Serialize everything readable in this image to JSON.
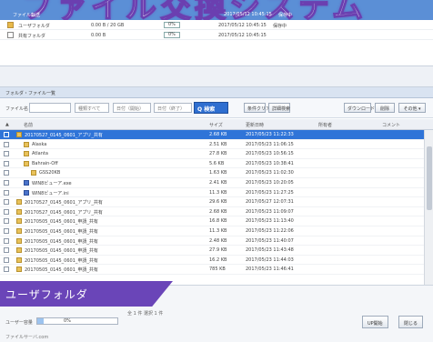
{
  "banner": {
    "title": "ファイル交換システム"
  },
  "upper_list": {
    "selected_row": {
      "name": "ファイル転送",
      "date": "2017/05/12 10:45:15",
      "status": "保存中"
    },
    "rows": [
      {
        "name": "ユーザフォルダ",
        "size": "0.00 B / 20 GB",
        "pct": "0%",
        "date": "2017/05/12 10:45:15",
        "status": "保存中"
      },
      {
        "name": "共有フォルダ",
        "size": "0.00 B",
        "pct": "0%",
        "date": "2017/05/12 10:45:15",
        "status": ""
      }
    ]
  },
  "panel_header": "フォルダ・ファイル一覧",
  "toolbar": {
    "filter_label": "ファイル名",
    "filter_value": "",
    "type_select": "種類すべて",
    "date_from": "日付（開始）",
    "date_to": "日付（終了）",
    "search_label": "Q 検索",
    "btn_clear": "条件クリア",
    "btn_detail": "詳細検索",
    "btn_download": "ダウンロード",
    "btn_delete": "削除",
    "btn_other": "その他 ▾"
  },
  "list_headers": {
    "name": "名前",
    "size": "サイズ",
    "updated": "更新日時",
    "owner": "所有者",
    "comment": "コメント"
  },
  "files": [
    {
      "name": "20170527_0145_0601_アプリ_共有",
      "size": "2.68 KB",
      "date": "2017/05/23 11:22:33",
      "icon": "folder",
      "selected": true,
      "indent": 0
    },
    {
      "name": "Alaska",
      "size": "2.51 KB",
      "date": "2017/05/23 11:06:15",
      "icon": "folder",
      "selected": false,
      "indent": 1
    },
    {
      "name": "Atlanta",
      "size": "27.8 KB",
      "date": "2017/05/23 10:56:15",
      "icon": "folder",
      "selected": false,
      "indent": 1
    },
    {
      "name": "Bahrain-Off",
      "size": "5.6 KB",
      "date": "2017/05/23 10:38:41",
      "icon": "folder",
      "selected": false,
      "indent": 1
    },
    {
      "name": "GSS20KB",
      "size": "1.63 KB",
      "date": "2017/05/23 11:02:30",
      "icon": "folder",
      "selected": false,
      "indent": 2
    },
    {
      "name": "WIN8ビューア.exe",
      "size": "2.41 KB",
      "date": "2017/05/23 10:20:05",
      "icon": "doc",
      "selected": false,
      "indent": 1
    },
    {
      "name": "WIN8ビューア.ini",
      "size": "11.3 KB",
      "date": "2017/05/23 11:27:25",
      "icon": "doc",
      "selected": false,
      "indent": 1
    },
    {
      "name": "20170527_0145_0601_アプリ_共有",
      "size": "29.6 KB",
      "date": "2017/05/27 12:07:31",
      "icon": "folder",
      "selected": false,
      "indent": 0
    },
    {
      "name": "20170527_0145_0601_アプリ_共有",
      "size": "2.68 KB",
      "date": "2017/05/23 11:09:07",
      "icon": "folder",
      "selected": false,
      "indent": 0
    },
    {
      "name": "20170505_0145_0601_申請_共有",
      "size": "16.8 KB",
      "date": "2017/05/23 11:13:40",
      "icon": "folder",
      "selected": false,
      "indent": 0
    },
    {
      "name": "20170505_0145_0601_申請_共有",
      "size": "11.3 KB",
      "date": "2017/05/23 11:22:06",
      "icon": "folder",
      "selected": false,
      "indent": 0
    },
    {
      "name": "20170505_0145_0601_申請_共有",
      "size": "2.48 KB",
      "date": "2017/05/23 11:40:07",
      "icon": "folder",
      "selected": false,
      "indent": 0
    },
    {
      "name": "20170505_0145_0601_申請_共有",
      "size": "27.9 KB",
      "date": "2017/05/23 11:43:48",
      "icon": "folder",
      "selected": false,
      "indent": 0
    },
    {
      "name": "20170505_0145_0601_申請_共有",
      "size": "16.2 KB",
      "date": "2017/05/23 11:44:03",
      "icon": "folder",
      "selected": false,
      "indent": 0
    },
    {
      "name": "20170505_0145_0601_申請_共有",
      "size": "785 KB",
      "date": "2017/05/23 11:46:41",
      "icon": "folder",
      "selected": false,
      "indent": 0
    }
  ],
  "bottom": {
    "badge": "ユーザフォルダ",
    "quota_label": "ユーザー容量",
    "quota_pct": "0%",
    "quota_fraction": 0.08,
    "info": "全 1 件 選択 1 件",
    "footer": "ファイルサーバ.com",
    "btn_upload": "UP開始",
    "btn_close": "閉じる"
  }
}
